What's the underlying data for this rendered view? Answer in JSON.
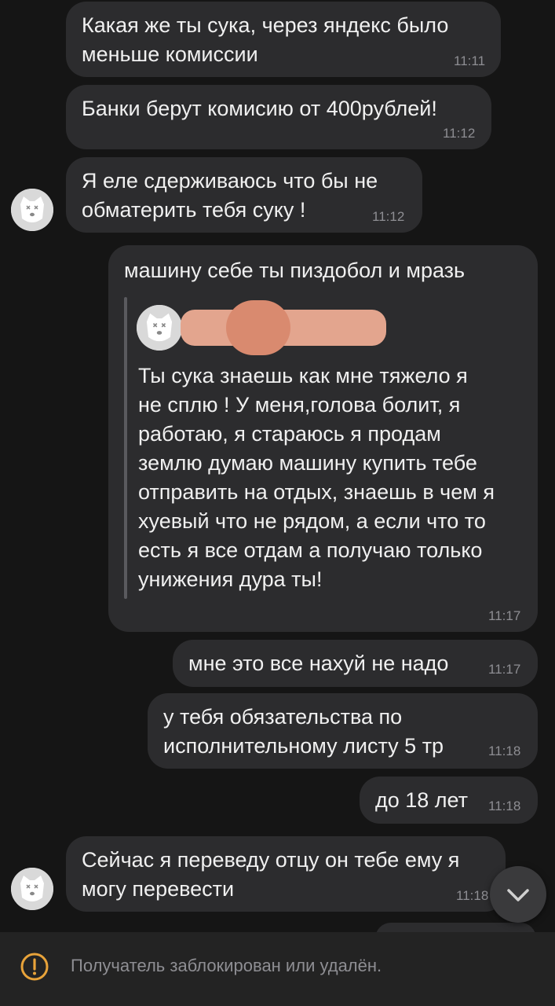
{
  "messages": [
    {
      "id": "m1",
      "text": "Какая же ты сука, через яндекс было\nменьше комиссии",
      "time": "11:11"
    },
    {
      "id": "m2",
      "text": "Банки берут комисию от 400рублей!",
      "time": "11:12"
    },
    {
      "id": "m3",
      "text": "Я еле сдерживаюсь что бы не\nобматерить тебя суку !",
      "time": "11:12"
    },
    {
      "id": "m4",
      "text": "машину себе ты пиздобол и мразь",
      "time": "11:17",
      "quote": {
        "text": "Ты сука знаешь как мне тяжело я\nне сплю ! У меня,голова болит, я\nработаю, я стараюсь я продам\nземлю думаю машину купить тебе\nотправить на отдых, знаешь в чем я\nхуевый что не рядом, а если что то\nесть я все отдам а получаю только\nунижения дура ты!"
      }
    },
    {
      "id": "m5",
      "text": "мне это все нахуй не надо",
      "time": "11:17"
    },
    {
      "id": "m6",
      "text": "у тебя обязательства по\nисполнительному листу 5 тр",
      "time": "11:18"
    },
    {
      "id": "m7",
      "text": "до 18 лет",
      "time": "11:18"
    },
    {
      "id": "m8",
      "text": "Сейчас я переведу отцу он тебе ему я\nмогу перевести",
      "time": "11:18"
    }
  ],
  "footer": {
    "notice": "Получатель заблокирован или удалён."
  },
  "colors": {
    "background": "#151515",
    "bubble": "#2c2c2e",
    "time": "#8e8e93",
    "warning": "#e8a33a"
  },
  "icons": {
    "avatar": "dog-avatar-icon",
    "scroll": "chevron-down-icon",
    "warning": "warning-icon"
  }
}
